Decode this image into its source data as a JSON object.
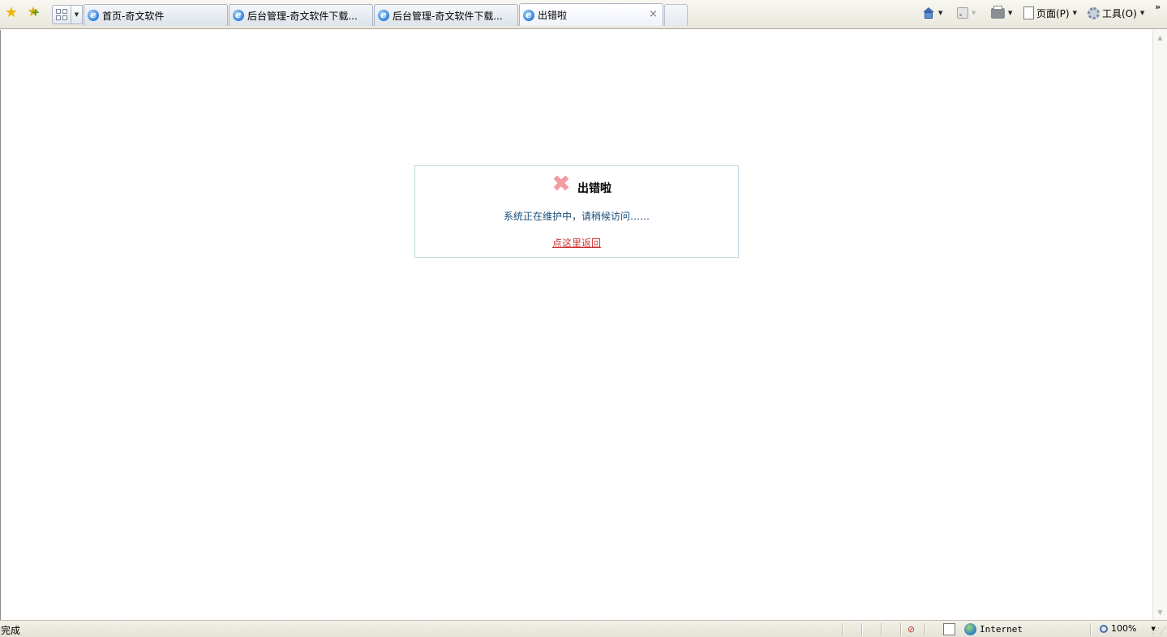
{
  "toolbar": {
    "favorites_icon": "star-icon",
    "add_favorites_icon": "add-favorite-icon",
    "quick_tabs_icon": "quick-tabs-icon",
    "tabs": [
      {
        "title": "首页-奇文软件",
        "active": false
      },
      {
        "title": "后台管理-奇文软件下载...",
        "active": false
      },
      {
        "title": "后台管理-奇文软件下载...",
        "active": false
      },
      {
        "title": "出错啦",
        "active": true
      }
    ],
    "tab_close_glyph": "×",
    "page_label": "页面(P)",
    "tools_label": "工具(O)",
    "more_glyph": "»"
  },
  "error": {
    "title": "出错啦",
    "message": "系统正在维护中，请稍候访问……",
    "back_link": "点这里返回",
    "icon": "error-x-icon",
    "icon_color": "#f49aa3"
  },
  "status": {
    "text": "完成",
    "zone": "Internet",
    "zoom": "100%"
  }
}
